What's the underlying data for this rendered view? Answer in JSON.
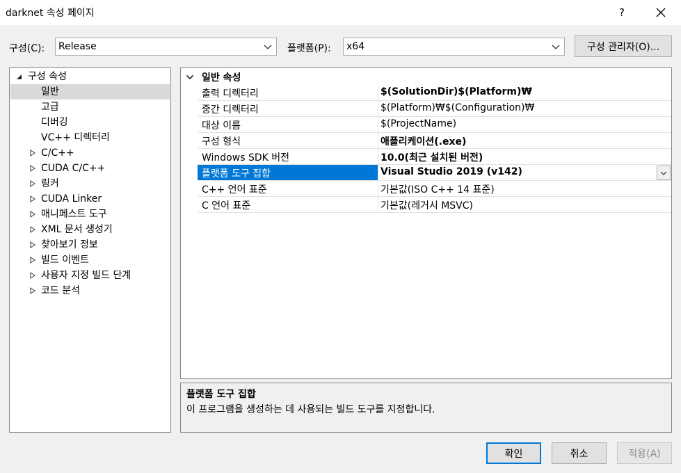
{
  "window": {
    "title": "darknet 속성 페이지",
    "help": "?",
    "close": "✕"
  },
  "config": {
    "label": "구성(C):",
    "value": "Release",
    "platform_label": "플랫폼(P):",
    "platform_value": "x64",
    "manager_button": "구성 관리자(O)..."
  },
  "tree": {
    "root": "구성 속성",
    "items": [
      {
        "label": "일반"
      },
      {
        "label": "고급"
      },
      {
        "label": "디버깅"
      },
      {
        "label": "VC++ 디렉터리"
      },
      {
        "label": "C/C++"
      },
      {
        "label": "CUDA C/C++"
      },
      {
        "label": "링커"
      },
      {
        "label": "CUDA Linker"
      },
      {
        "label": "매니페스트 도구"
      },
      {
        "label": "XML 문서 생성기"
      },
      {
        "label": "찾아보기 정보"
      },
      {
        "label": "빌드 이벤트"
      },
      {
        "label": "사용자 지정 빌드 단계"
      },
      {
        "label": "코드 분석"
      }
    ]
  },
  "grid": {
    "category": "일반 속성",
    "rows": [
      {
        "name": "출력 디렉터리",
        "value": "$(SolutionDir)$(Platform)₩"
      },
      {
        "name": "중간 디렉터리",
        "value": "$(Platform)₩$(Configuration)₩"
      },
      {
        "name": "대상 이름",
        "value": "$(ProjectName)"
      },
      {
        "name": "구성 형식",
        "value": "애플리케이션(.exe)"
      },
      {
        "name": "Windows SDK 버전",
        "value": "10.0(최근 설치된 버전)"
      },
      {
        "name": "플랫폼 도구 집합",
        "value": "Visual Studio 2019 (v142)"
      },
      {
        "name": "C++ 언어 표준",
        "value": "기본값(ISO C++ 14 표준)"
      },
      {
        "name": "C 언어 표준",
        "value": "기본값(레거시 MSVC)"
      }
    ]
  },
  "description": {
    "title": "플랫폼 도구 집합",
    "text": "이 프로그램을 생성하는 데 사용되는 빌드 도구를 지정합니다."
  },
  "buttons": {
    "ok": "확인",
    "cancel": "취소",
    "apply": "적용(A)"
  },
  "colors": {
    "accent": "#0078d7",
    "tree_selected": "#d9d9d9"
  }
}
